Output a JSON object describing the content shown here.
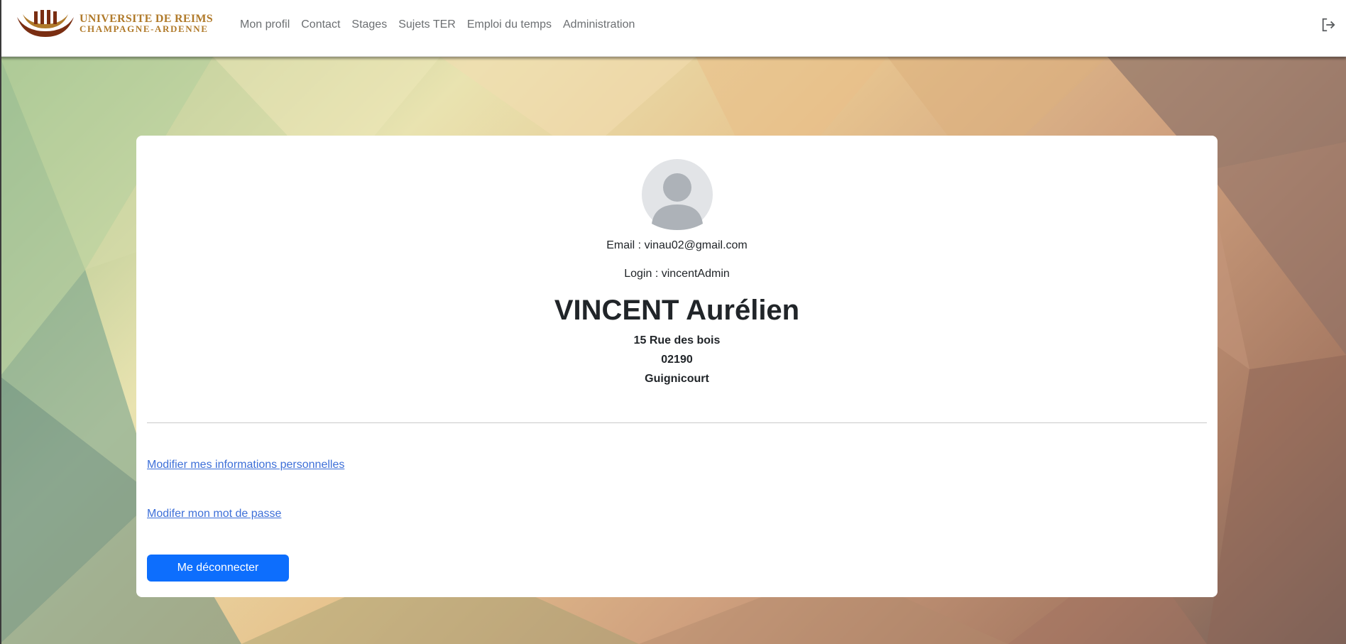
{
  "brand": {
    "line1": "UNIVERSITE DE REIMS",
    "line2": "CHAMPAGNE-ARDENNE"
  },
  "nav": {
    "items": [
      "Mon profil",
      "Contact",
      "Stages",
      "Sujets TER",
      "Emploi du temps",
      "Administration"
    ],
    "logout_icon": "logout-icon"
  },
  "profile": {
    "avatar_icon": "user-avatar-icon",
    "email": "Email : vinau02@gmail.com",
    "login": "Login : vincentAdmin",
    "name": "VINCENT Aurélien",
    "address_street": "15 Rue des bois",
    "address_postcode": "02190",
    "address_city": "Guignicourt"
  },
  "actions": {
    "edit_info_link": "Modifier mes informations personnelles",
    "edit_password_link": "Modifer mon mot de passe",
    "logout_button": "Me déconnecter"
  },
  "colors": {
    "primary_button": "#0d6efd",
    "link": "#3d6fd8",
    "brand_gold": "#b07a2a",
    "brand_brown": "#7a2e12"
  }
}
